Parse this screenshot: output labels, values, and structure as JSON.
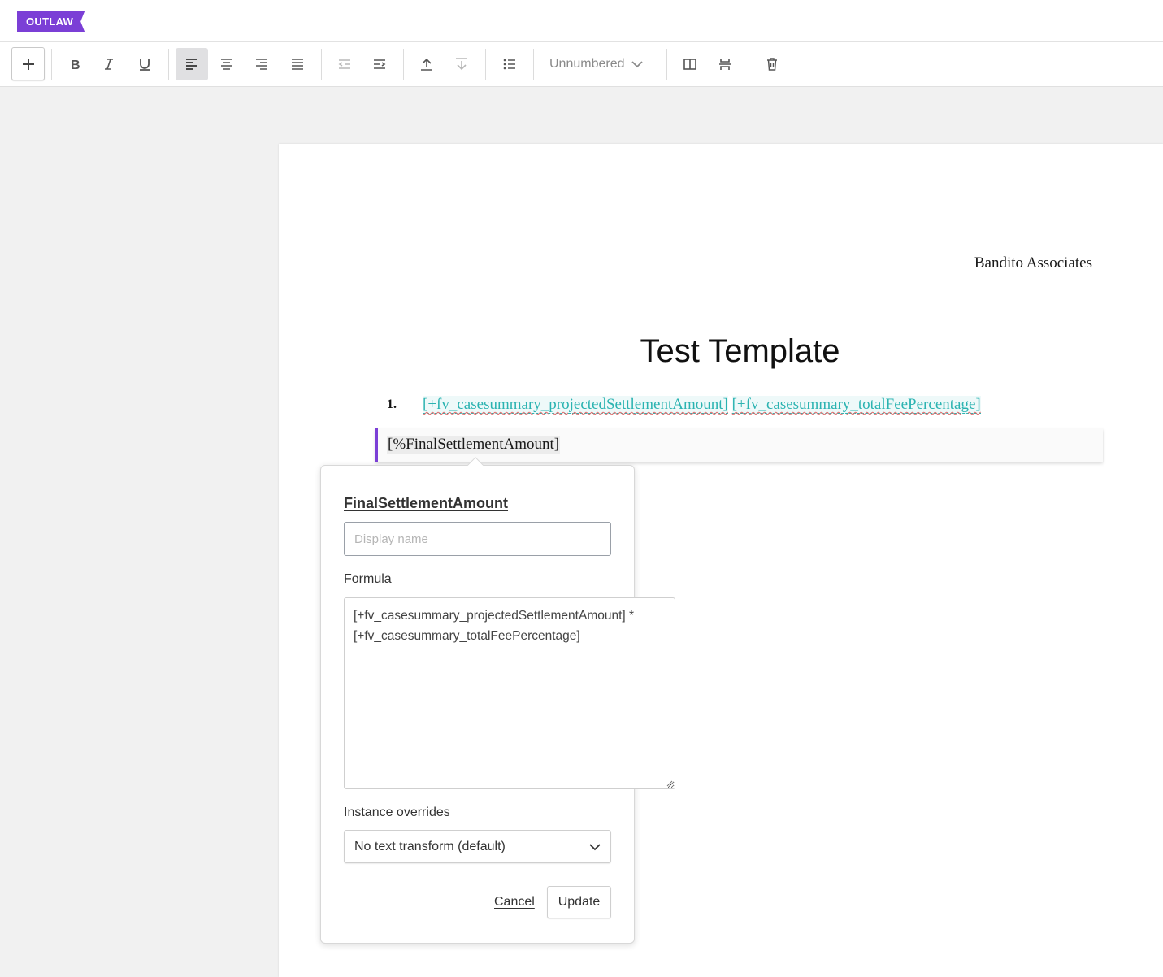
{
  "app": {
    "logo": "OUTLAW"
  },
  "toolbar": {
    "add_icon": "plus-icon",
    "numbering": {
      "selected": "Unnumbered"
    },
    "accent": "#7b3fd6"
  },
  "document": {
    "firm_name": "Bandito Associates",
    "title": "Test Template",
    "list_item": {
      "number": "1.",
      "fields": [
        "[+fv_casesummary_projectedSettlementAmount]",
        "[+fv_casesummary_totalFeePercentage]"
      ]
    },
    "selected_field": "[%FinalSettlementAmount]"
  },
  "popover": {
    "title": "FinalSettlementAmount",
    "display_name": {
      "value": "",
      "placeholder": "Display name"
    },
    "formula_label": "Formula",
    "formula_lines": [
      "[+fv_casesummary_projectedSettlementAmount] *",
      "[+fv_casesummary_totalFeePercentage]"
    ],
    "overrides_label": "Instance overrides",
    "overrides_selected": "No text transform (default)",
    "cancel_label": "Cancel",
    "update_label": "Update"
  }
}
